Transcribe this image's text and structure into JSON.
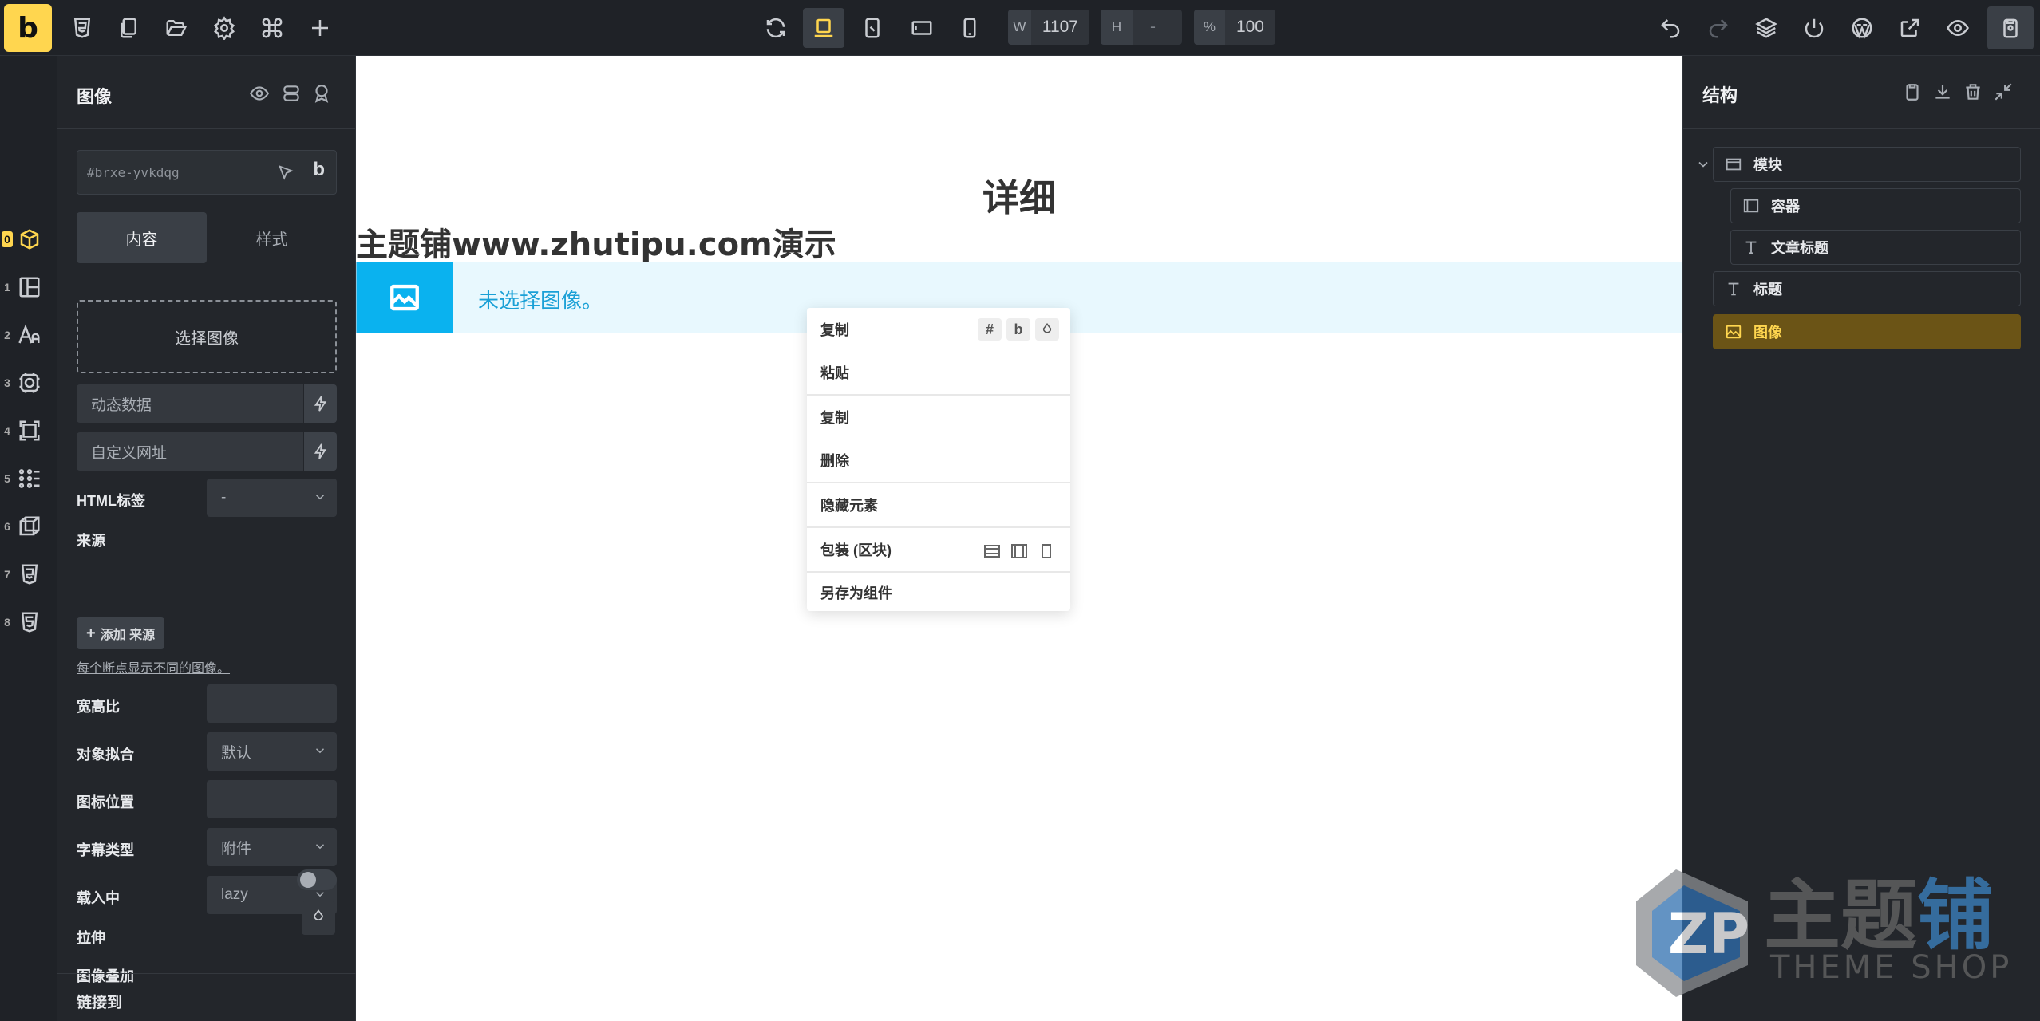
{
  "topbar": {
    "logo_letter": "b",
    "width_key": "W",
    "width_value": "1107",
    "height_key": "H",
    "height_value": "-",
    "zoom_key": "%",
    "zoom_value": "100"
  },
  "rail": {
    "items": [
      {
        "num": "0",
        "icon": "box-icon"
      },
      {
        "num": "1",
        "icon": "layout-icon"
      },
      {
        "num": "2",
        "icon": "typography-icon"
      },
      {
        "num": "3",
        "icon": "gear-frame-icon"
      },
      {
        "num": "4",
        "icon": "frame-icon"
      },
      {
        "num": "5",
        "icon": "dots-grid-icon"
      },
      {
        "num": "6",
        "icon": "cube-icon"
      },
      {
        "num": "7",
        "icon": "css3-icon"
      },
      {
        "num": "8",
        "icon": "html5-icon"
      }
    ]
  },
  "left_panel": {
    "title": "图像",
    "element_id": "#brxe-yvkdqg",
    "id_b": "b",
    "tabs": [
      "内容",
      "样式"
    ],
    "choose_image": "选择图像",
    "dynamic_data": "动态数据",
    "custom_url": "自定义网址",
    "html_tag_label": "HTML标签",
    "html_tag_value": "-",
    "source_label": "来源",
    "add_source": "添加 来源",
    "source_hint": "每个断点显示不同的图像。",
    "aspect_ratio_label": "宽高比",
    "object_fit_label": "对象拟合",
    "object_fit_value": "默认",
    "icon_position_label": "图标位置",
    "caption_type_label": "字幕类型",
    "caption_type_value": "附件",
    "loading_label": "载入中",
    "loading_value": "lazy",
    "stretch_label": "拉伸",
    "overlay_label": "图像叠加",
    "link_to_label": "链接到"
  },
  "canvas": {
    "heading": "详细",
    "article_title": "主题铺www.zhutipu.com演示",
    "no_image_msg": "未选择图像。"
  },
  "context_menu": {
    "items": [
      "复制",
      "粘贴",
      "复制",
      "删除",
      "隐藏元素",
      "包装 (区块)",
      "另存为组件"
    ],
    "tool_hash": "#",
    "tool_b": "b"
  },
  "right_panel": {
    "title": "结构",
    "tree": [
      {
        "label": "模块",
        "icon": "section-icon"
      },
      {
        "label": "容器",
        "icon": "container-icon"
      },
      {
        "label": "文章标题",
        "icon": "text-icon"
      },
      {
        "label": "标题",
        "icon": "text-icon"
      },
      {
        "label": "图像",
        "icon": "image-icon"
      }
    ]
  },
  "watermark": {
    "text_plain": "主题",
    "text_highlight": "铺",
    "sub": "THEME SHOP"
  }
}
